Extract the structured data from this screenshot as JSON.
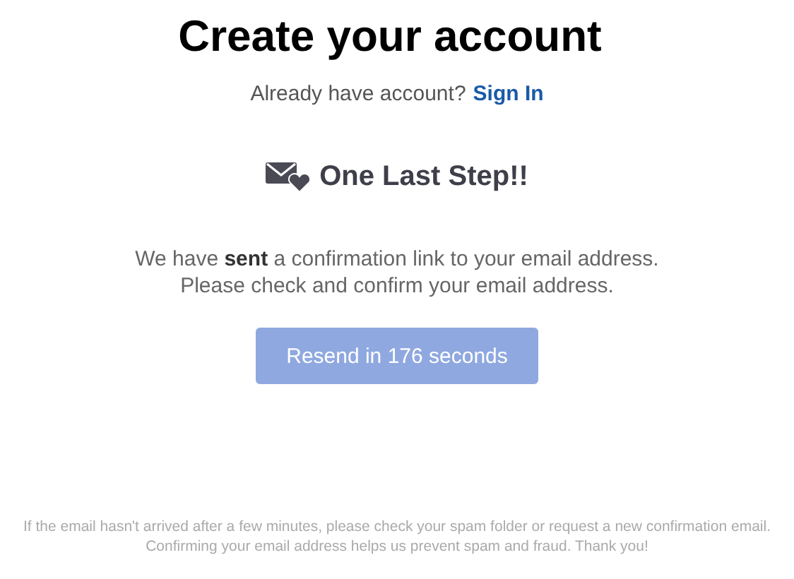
{
  "title": "Create your account",
  "signin_prompt": {
    "text": "Already have account?",
    "link": "Sign In"
  },
  "step": {
    "heading": "One Last Step!!"
  },
  "message": [
    "We have **sent** a confirmation link to your email address.",
    "Please check and confirm your email address."
  ],
  "resend_button": {
    "label": "Resend in 176 seconds",
    "disabled": true
  },
  "footer_note": "If the email hasn't arrived after a few minutes, please check your spam folder or request a new confirmation email. Confirming your email address helps us prevent spam and fraud. Thank you!"
}
